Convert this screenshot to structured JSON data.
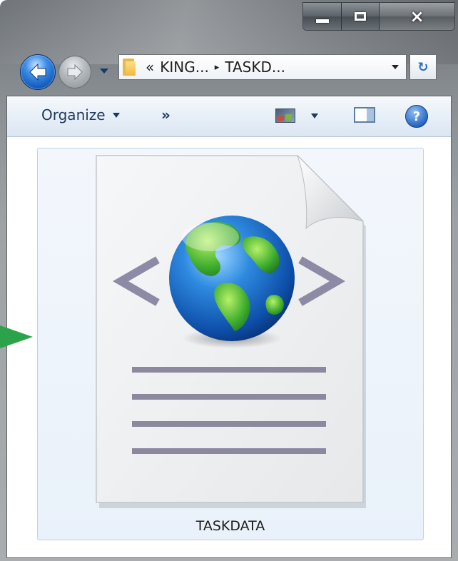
{
  "window": {
    "caption_buttons": {
      "minimize": "minimize-icon",
      "maximize": "maximize-icon",
      "close": "×"
    }
  },
  "navigation": {
    "back": "back-arrow-icon",
    "forward": "forward-arrow-icon",
    "address": {
      "prefix": "«",
      "segments": [
        "KING...",
        "TASKD..."
      ],
      "separator": "▸"
    },
    "refresh": "↻"
  },
  "toolbar": {
    "organize_label": "Organize",
    "more_label": "»",
    "help_label": "?"
  },
  "content": {
    "item_name": "TASKDATA",
    "item_icon": "html-document-globe-icon"
  },
  "colors": {
    "accent_blue": "#1257b8",
    "arrow_green": "#2aa34a",
    "tile_border": "#bcd3ea"
  }
}
